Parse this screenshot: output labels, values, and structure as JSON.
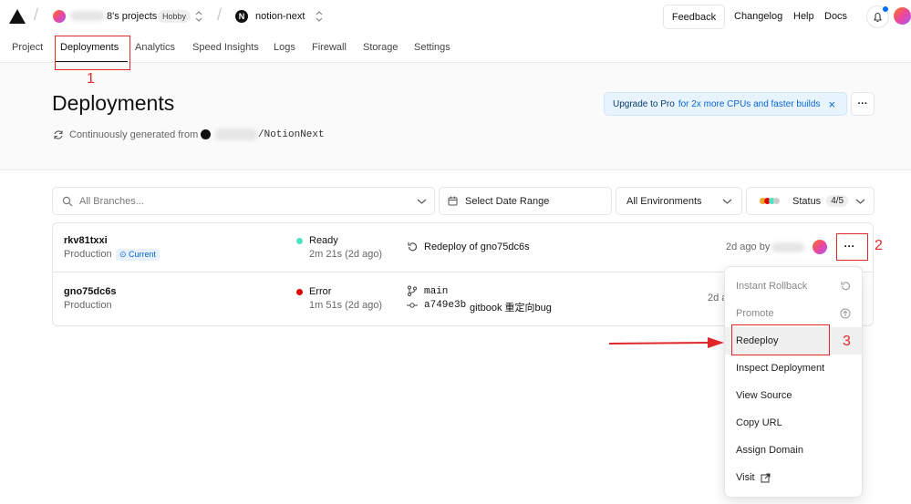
{
  "topbar": {
    "project_owner": "8's projects",
    "plan_badge": "Hobby",
    "project_name": "notion-next",
    "feedback": "Feedback",
    "changelog": "Changelog",
    "help": "Help",
    "docs": "Docs"
  },
  "nav": {
    "tabs": [
      "Project",
      "Deployments",
      "Analytics",
      "Speed Insights",
      "Logs",
      "Firewall",
      "Storage",
      "Settings"
    ],
    "active": "Deployments"
  },
  "header": {
    "title": "Deployments",
    "source_prefix": "Continuously generated from",
    "repo_suffix": "/NotionNext",
    "upgrade_strong": "Upgrade to Pro",
    "upgrade_rest": "for 2x more CPUs and faster builds",
    "close": "×",
    "more": "···"
  },
  "filters": {
    "branch_placeholder": "All Branches...",
    "date_range": "Select Date Range",
    "environments": "All Environments",
    "status_label": "Status",
    "status_count": "4/5"
  },
  "deployments": [
    {
      "id": "rkv81txxi",
      "env": "Production",
      "badge": "Current",
      "status": "Ready",
      "status_color": "#50e3c2",
      "duration": "2m 21s (2d ago)",
      "source_line1": "Redeploy of gno75dc6s",
      "time": "2d ago by",
      "more": "···"
    },
    {
      "id": "gno75dc6s",
      "env": "Production",
      "status": "Error",
      "status_color": "#e00000",
      "duration": "1m 51s (2d ago)",
      "branch": "main",
      "commit_hash": "a749e3b",
      "commit_msg": "gitbook 重定向bug",
      "time": "2d a"
    }
  ],
  "menu": {
    "items": [
      {
        "label": "Instant Rollback",
        "disabled": true
      },
      {
        "label": "Promote",
        "disabled": true
      },
      {
        "label": "Redeploy",
        "disabled": false
      },
      {
        "label": "Inspect Deployment",
        "disabled": false
      },
      {
        "label": "View Source",
        "disabled": false
      },
      {
        "label": "Copy URL",
        "disabled": false
      },
      {
        "label": "Assign Domain",
        "disabled": false
      },
      {
        "label": "Visit",
        "disabled": false
      }
    ]
  },
  "annotations": {
    "n1": "1",
    "n2": "2",
    "n3": "3"
  }
}
